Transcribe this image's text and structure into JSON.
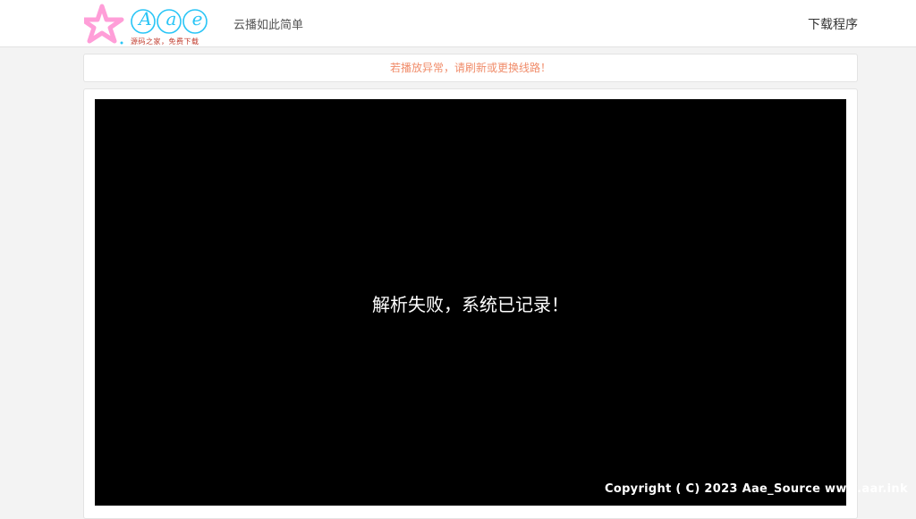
{
  "header": {
    "logo_text": "Aae",
    "logo_tagline": "源码之家，免费下载",
    "site_title": "云播如此简单",
    "download_label": "下载程序"
  },
  "notice": {
    "text": "若播放异常，请刷新或更换线路！"
  },
  "player": {
    "message": "解析失败，系统已记录！"
  },
  "footer": {
    "copyright": "Copyright ( C) 2023 Aae_Source www.aar.ink"
  },
  "colors": {
    "notice_text": "#f08c6a",
    "logo_star": "#ff9ed8",
    "logo_letters": "#29c5f6",
    "player_bg": "#000000"
  }
}
